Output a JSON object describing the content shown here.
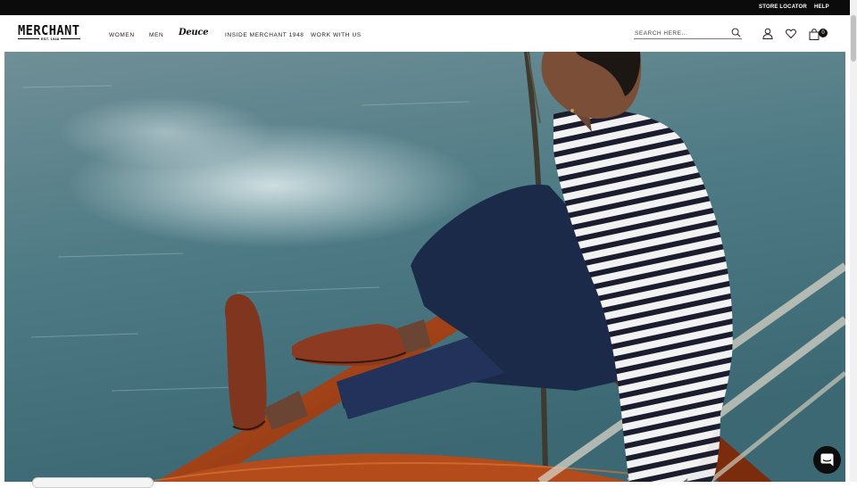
{
  "topbar": {
    "store_locator": "STORE LOCATOR",
    "help": "HELP"
  },
  "brand": {
    "name": "MERCHANT",
    "est": "EST. 1948"
  },
  "nav": {
    "women": "WOMEN",
    "men": "MEN",
    "deuce": "Deuce",
    "inside": "INSIDE MERCHANT 1948",
    "work": "WORK WITH US"
  },
  "search": {
    "placeholder": "SEARCH HERE..."
  },
  "cart": {
    "count": "0"
  },
  "hero": {
    "alt": "Man in a striped sweater and navy trousers wearing brown loafers, seated on the bow of a wooden boat over the sea"
  },
  "icons": {
    "search": "search-icon",
    "account": "user-icon",
    "wishlist": "heart-icon",
    "cart": "shopping-bag-icon",
    "chat": "chat-icon"
  },
  "colors": {
    "topbar": "#0b0b0b",
    "text": "#222222",
    "water": "#5e8a94",
    "boat": "#9a3e16"
  }
}
